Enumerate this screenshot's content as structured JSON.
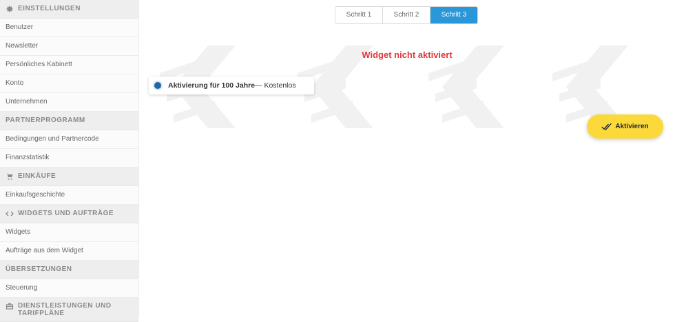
{
  "sidebar": {
    "sections": [
      {
        "heading": "EINSTELLUNGEN",
        "icon": "gear-icon",
        "items": [
          "Benutzer",
          "Newsletter",
          "Persönliches Kabinett",
          "Konto",
          "Unternehmen"
        ]
      },
      {
        "heading": "PARTNERPROGRAMM",
        "icon": "",
        "items": [
          "Bedingungen und Partnercode",
          "Finanzstatistik"
        ]
      },
      {
        "heading": "EINKÄUFE",
        "icon": "cart-icon",
        "items": [
          "Einkaufsgeschichte"
        ]
      },
      {
        "heading": "WIDGETS UND AUFTRÄGE",
        "icon": "code-icon",
        "items": [
          "Widgets",
          "Aufträge aus dem Widget"
        ]
      },
      {
        "heading": "ÜBERSETZUNGEN",
        "icon": "",
        "items": [
          "Steuerung"
        ]
      },
      {
        "heading_line1": "DIENSTLEISTUNGEN UND",
        "heading_line2": "TARIFPLÄNE",
        "icon": "briefcase-icon",
        "items": []
      }
    ]
  },
  "steps": {
    "step1": "Schritt 1",
    "step2": "Schritt 2",
    "step3": "Schritt 3",
    "active": "Schritt 3"
  },
  "status": {
    "text": "Widget nicht aktiviert",
    "color": "#e2373a"
  },
  "option": {
    "bold": "Aktivierung für 100 Jahre",
    "suffix": " — Kostenlos"
  },
  "activate_button": {
    "label": "Aktivieren",
    "icon": "double-check-icon",
    "color": "#fbd93a"
  },
  "accent_color": "#2a97d9"
}
